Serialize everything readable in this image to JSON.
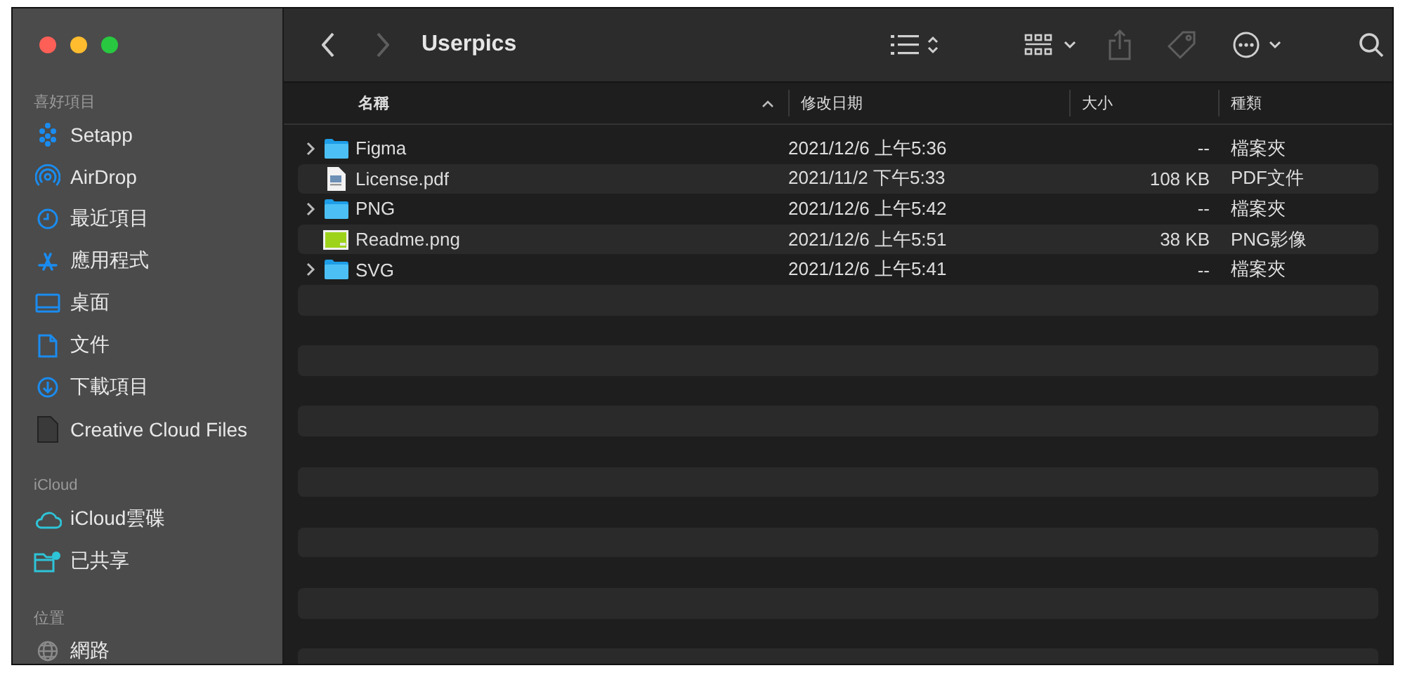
{
  "window": {
    "title": "Userpics"
  },
  "toolbar": {
    "back_enabled": true,
    "forward_enabled": false,
    "share_enabled": false,
    "tag_enabled": false
  },
  "sidebar": {
    "sections": [
      {
        "title": "喜好項目",
        "items": [
          {
            "label": "Setapp"
          },
          {
            "label": "AirDrop"
          },
          {
            "label": "最近項目"
          },
          {
            "label": "應用程式"
          },
          {
            "label": "桌面"
          },
          {
            "label": "文件"
          },
          {
            "label": "下載項目"
          },
          {
            "label": "Creative Cloud Files"
          }
        ]
      },
      {
        "title": "iCloud",
        "items": [
          {
            "label": "iCloud雲碟"
          },
          {
            "label": "已共享"
          }
        ]
      },
      {
        "title": "位置",
        "items": [
          {
            "label": "網路"
          }
        ]
      }
    ]
  },
  "table": {
    "columns": [
      {
        "label": "名稱",
        "sorted": true
      },
      {
        "label": "修改日期",
        "sorted": false
      },
      {
        "label": "大小",
        "sorted": false
      },
      {
        "label": "種類",
        "sorted": false
      }
    ],
    "rows": [
      {
        "kind": "folder",
        "name": "Figma",
        "modified": "2021/12/6 上午5:36",
        "size": "--",
        "type": "檔案夾"
      },
      {
        "kind": "pdf",
        "name": "License.pdf",
        "modified": "2021/11/2 下午5:33",
        "size": "108 KB",
        "type": "PDF文件"
      },
      {
        "kind": "folder",
        "name": "PNG",
        "modified": "2021/12/6 上午5:42",
        "size": "--",
        "type": "檔案夾"
      },
      {
        "kind": "image",
        "name": "Readme.png",
        "modified": "2021/12/6 上午5:51",
        "size": "38 KB",
        "type": "PNG影像"
      },
      {
        "kind": "folder",
        "name": "SVG",
        "modified": "2021/12/6 上午5:41",
        "size": "--",
        "type": "檔案夾"
      }
    ]
  }
}
